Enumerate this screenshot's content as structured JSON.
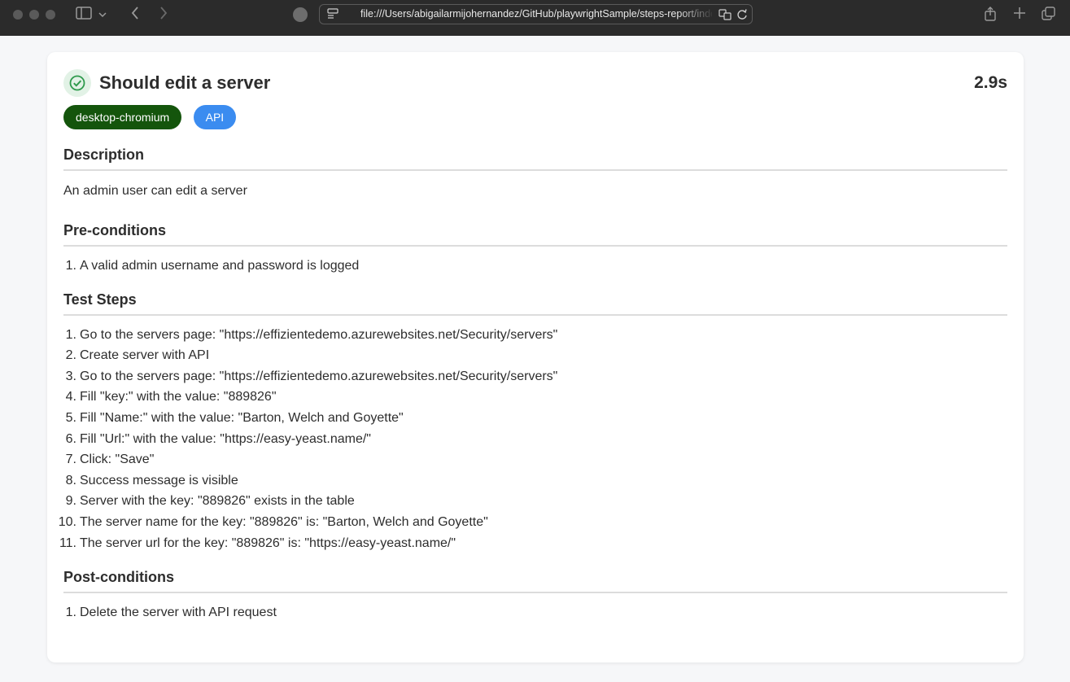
{
  "browser": {
    "url": "file:///Users/abigailarmijohernandez/GitHub/playwrightSample/steps-report/index.html"
  },
  "report": {
    "title": "Should edit a server",
    "duration": "2.9s",
    "status": "passed",
    "tags": [
      "desktop-chromium",
      "API"
    ],
    "description": {
      "heading": "Description",
      "text": "An admin user can edit a server"
    },
    "preconditions": {
      "heading": "Pre-conditions",
      "items": [
        "A valid admin username and password is logged"
      ]
    },
    "test_steps": {
      "heading": "Test Steps",
      "items": [
        "Go to the servers page: \"https://effizientedemo.azurewebsites.net/Security/servers\"",
        "Create server with API",
        "Go to the servers page: \"https://effizientedemo.azurewebsites.net/Security/servers\"",
        "Fill \"key:\" with the value: \"889826\"",
        "Fill \"Name:\" with the value: \"Barton, Welch and Goyette\"",
        "Fill \"Url:\" with the value: \"https://easy-yeast.name/\"",
        "Click: \"Save\"",
        "Success message is visible",
        "Server with the key: \"889826\" exists in the table",
        "The server name for the key: \"889826\" is: \"Barton, Welch and Goyette\"",
        "The server url for the key: \"889826\" is: \"https://easy-yeast.name/\""
      ]
    },
    "postconditions": {
      "heading": "Post-conditions",
      "items": [
        "Delete the server with API request"
      ]
    }
  },
  "colors": {
    "toolbar_bg": "#2b2b2b",
    "page_bg": "#f6f7f9",
    "tag_project": "#14550c",
    "tag_api": "#3b8cf0",
    "status_success": "#2e9a4c"
  }
}
